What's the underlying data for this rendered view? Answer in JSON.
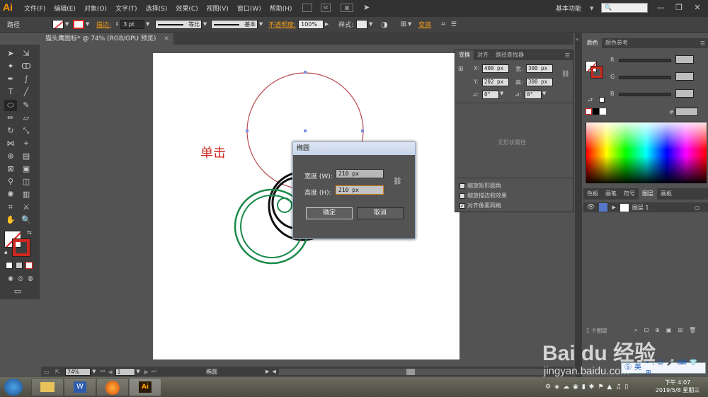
{
  "app": {
    "logo": "Ai"
  },
  "menu": {
    "items": [
      "文件(F)",
      "编辑(E)",
      "对象(O)",
      "文字(T)",
      "选择(S)",
      "效果(C)",
      "视图(V)",
      "窗口(W)",
      "帮助(H)"
    ],
    "st_icon": "St",
    "workspace": "基本功能",
    "window_controls": [
      "—",
      "❐",
      "✕"
    ]
  },
  "control": {
    "path_label": "路径",
    "stroke_label": "描边:",
    "stroke_value": "3 pt",
    "profile_label": "等比",
    "brush_label": "基本",
    "opacity_label": "不透明度:",
    "opacity_value": "100%",
    "style_label": "样式:",
    "transform_label": "变换"
  },
  "document": {
    "tab_title": "猫头鹰图标* @ 74% (RGB/GPU 预览)",
    "close": "✕"
  },
  "annotation": {
    "text": "单击",
    "color": "#d0271f"
  },
  "dialog": {
    "title": "椭圆",
    "width_label": "宽度 (W):",
    "width_value": "210 px",
    "height_label": "高度 (H):",
    "height_value": "210 px",
    "ok": "确定",
    "cancel": "取消"
  },
  "transform_panel": {
    "tabs": [
      "变换",
      "对齐",
      "路径查找器"
    ],
    "x_label": "X:",
    "x_value": "400 px",
    "y_label": "Y:",
    "y_value": "202 px",
    "w_label": "宽:",
    "w_value": "300 px",
    "h_label": "高:",
    "h_value": "300 px",
    "angle_value": "0°",
    "shear_value": "0°",
    "no_shape_props": "无形状属性",
    "scale_corners": "缩放矩形圆角",
    "scale_strokes": "缩放描边和效果",
    "align_pixel": "对齐像素网格"
  },
  "color_panel": {
    "tabs": [
      "颜色",
      "颜色参考"
    ],
    "r": "R",
    "g": "G",
    "b": "B",
    "hash": "#"
  },
  "layers_panel": {
    "tabs": [
      "色板",
      "画笔",
      "符号",
      "图层",
      "画板"
    ],
    "layer_name": "图层 1",
    "footer": "1 个图层"
  },
  "status": {
    "zoom": "74%",
    "page": "1",
    "tool": "椭圆"
  },
  "taskbar": {
    "time": "下午 4:07",
    "date": "2019/5/8 星期三"
  },
  "ime": {
    "label": "英"
  },
  "watermark": {
    "brand": "Bai du 经验",
    "url": "jingyan.baidu.com"
  },
  "colors": {
    "stroke_red": "#d0271f",
    "green": "#1a8a4a",
    "orange_link": "#f19b16"
  }
}
